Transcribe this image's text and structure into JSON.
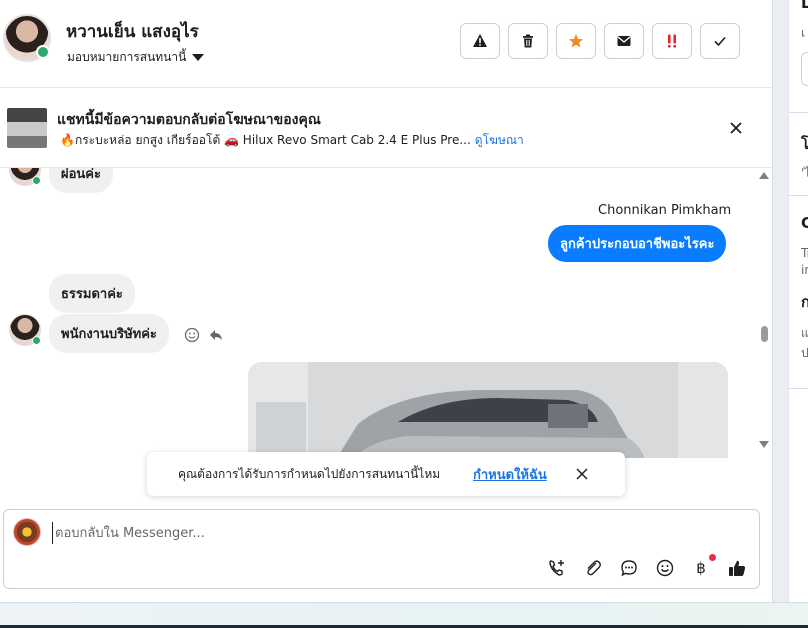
{
  "header": {
    "user_name": "หวานเย็น แสงอุไร",
    "assign_label": "มอบหมายการสนทนานี้"
  },
  "ad": {
    "title": "แชทนี้มีข้อความตอบกลับต่อโฆษณาของคุณ",
    "subtitle": "🔥กระบะหล่อ ยกสูง เกียร์ออโต้ 🚗 Hilux Revo Smart Cab 2.4 E Plus Pre...",
    "link": "ดูโฆษณา"
  },
  "messages": {
    "partial_in": "ผ่อนค่ะ",
    "sender_out": "Chonnikan Pimkham",
    "out_1": "ลูกค้าประกอบอาชีพอะไรคะ",
    "in_1": "ธรรมดาค่ะ",
    "in_2": "พนักงานบริษัทค่ะ"
  },
  "toast": {
    "text": "คุณต้องการได้รับการกำหนดไปยังการสนทนานี้ไหม",
    "link": "กำหนดให้ฉัน"
  },
  "composer": {
    "placeholder": "ตอบกลับใน Messenger..."
  },
  "right_panel": {
    "frag_1": "L",
    "frag_2": "เ",
    "frag_3": "โ",
    "frag_4": "'ไ",
    "frag_5": "C",
    "frag_6": "Tr",
    "frag_7": "in",
    "frag_8": "ก",
    "frag_9": "แ",
    "frag_10": "ป"
  },
  "colors": {
    "brand_blue": "#0a7cff",
    "link_blue": "#1b74e4",
    "star": "#f08a24",
    "urgent": "#e4262d",
    "online": "#2fa86b"
  }
}
